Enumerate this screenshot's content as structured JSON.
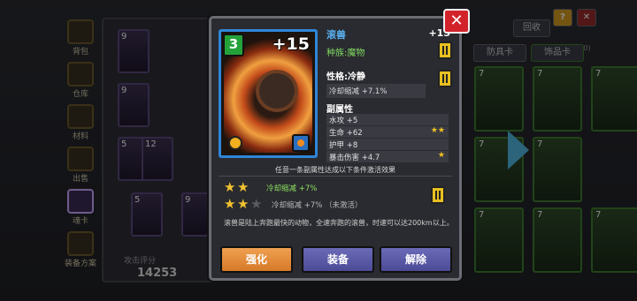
{
  "background": {
    "nav": [
      {
        "label": "背包"
      },
      {
        "label": "仓库"
      },
      {
        "label": "材料"
      },
      {
        "label": "出售"
      },
      {
        "label": "魂卡"
      },
      {
        "label": "装备方案"
      }
    ],
    "cards": [
      {
        "level": "9"
      },
      {
        "level": "9"
      },
      {
        "level": "5"
      },
      {
        "level": "12"
      },
      {
        "level": "5"
      },
      {
        "level": "9"
      }
    ],
    "score_label": "攻击评分",
    "score_value": "14253",
    "recycle_label": "回收",
    "count_label": "(197/300)",
    "filter1": "防具卡",
    "filter2": "饰品卡",
    "help_icon": "?",
    "close_bg": "✕",
    "right_cards": [
      "7",
      "7",
      "7",
      "7",
      "7",
      "7",
      "7",
      "7"
    ]
  },
  "modal": {
    "card_level": "3",
    "card_plus": "+15",
    "name": "滚兽",
    "plus": "+15",
    "race": "种族:魔物",
    "trait_title": "性格:冷静",
    "trait_value": "冷却缩减 +7.1%",
    "sub_title": "副属性",
    "sub_stats": [
      {
        "label": "水攻 +5",
        "stars": ""
      },
      {
        "label": "生命 +62",
        "stars": "★★"
      },
      {
        "label": "护甲 +8",
        "stars": ""
      },
      {
        "label": "暴击伤害 +4.7",
        "stars": "★"
      }
    ],
    "note": "任意一条副属性达成以下条件激活效果",
    "conditions": [
      {
        "text": "冷却缩减 +7%",
        "state": "active"
      },
      {
        "text": "冷却缩减 +7%  （未激活）",
        "state": "inactive"
      }
    ],
    "description": "滚兽是陆上奔跑最快的动物，全速奔跑的滚兽，时速可以达200km以上。",
    "buttons": {
      "enhance": "强化",
      "equip": "装备",
      "remove": "解除"
    },
    "close": "✕"
  }
}
